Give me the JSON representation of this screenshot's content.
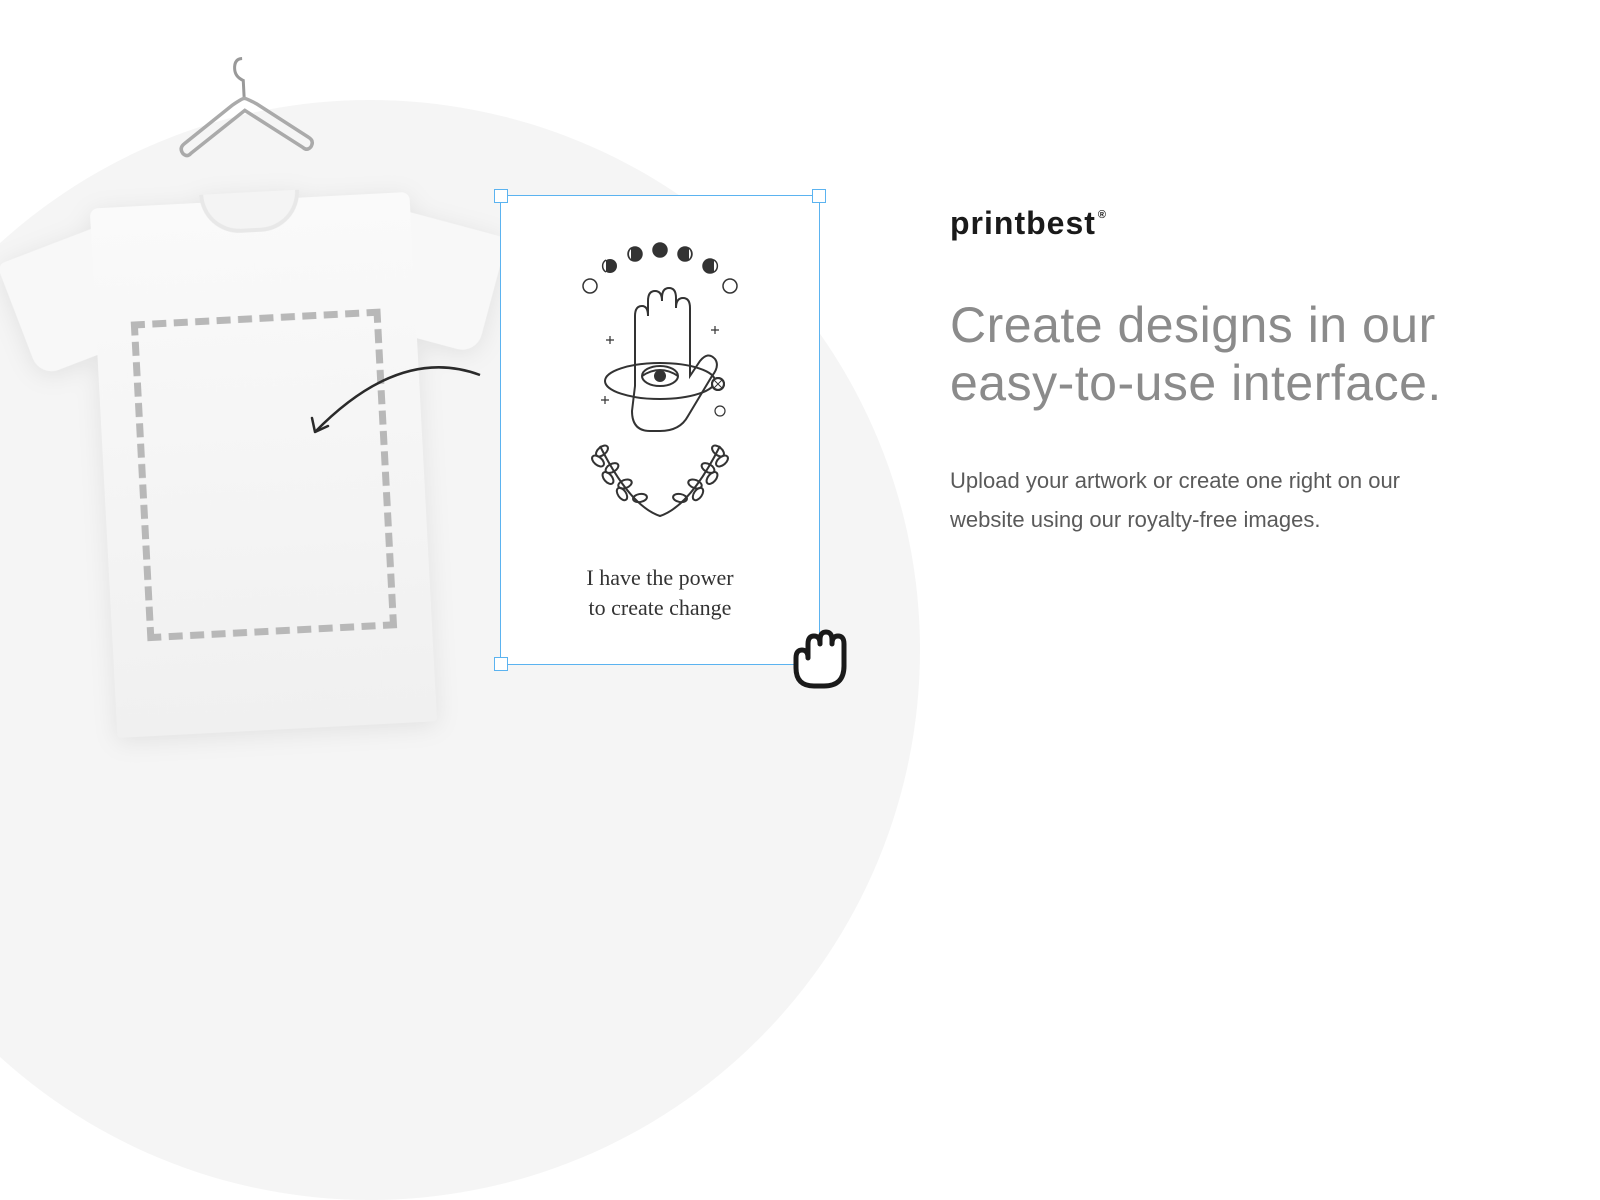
{
  "logo": {
    "text": "printbest",
    "mark": "®"
  },
  "headline": "Create designs in our easy-to-use interface.",
  "description": "Upload your artwork or create one right on our website using our royalty-free images.",
  "artwork": {
    "line1": "I have the power",
    "line2": "to create change"
  },
  "colors": {
    "selection_border": "#5bb3f0",
    "bg_shape": "#f5f5f5",
    "headline": "#8b8b8b",
    "body_text": "#5a5a5a"
  }
}
